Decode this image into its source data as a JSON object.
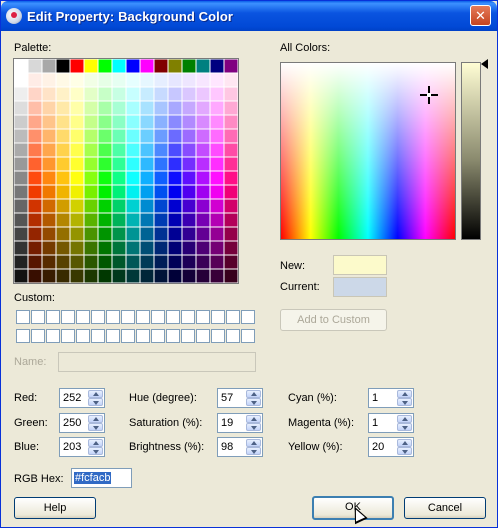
{
  "window": {
    "title": "Edit Property: Background Color",
    "close_glyph": "✕"
  },
  "palette": {
    "label": "Palette:"
  },
  "all_colors": {
    "label": "All Colors:"
  },
  "preview": {
    "new_label": "New:",
    "current_label": "Current:",
    "new_color": "#fcfacb",
    "current_color": "#ccd8e8"
  },
  "custom": {
    "label": "Custom:",
    "add_button": "Add to Custom",
    "name_label": "Name:",
    "name_value": ""
  },
  "fields": {
    "red": {
      "label": "Red:",
      "value": "252"
    },
    "green": {
      "label": "Green:",
      "value": "250"
    },
    "blue": {
      "label": "Blue:",
      "value": "203"
    },
    "hue": {
      "label": "Hue (degree):",
      "value": "57"
    },
    "saturation": {
      "label": "Saturation (%):",
      "value": "19"
    },
    "brightness": {
      "label": "Brightness (%):",
      "value": "98"
    },
    "cyan": {
      "label": "Cyan (%):",
      "value": "1"
    },
    "magenta": {
      "label": "Magenta (%):",
      "value": "1"
    },
    "yellow": {
      "label": "Yellow (%):",
      "value": "20"
    }
  },
  "hex": {
    "label": "RGB Hex:",
    "value": "#fcfacb"
  },
  "buttons": {
    "help": "Help",
    "ok": "OK",
    "cancel": "Cancel"
  }
}
